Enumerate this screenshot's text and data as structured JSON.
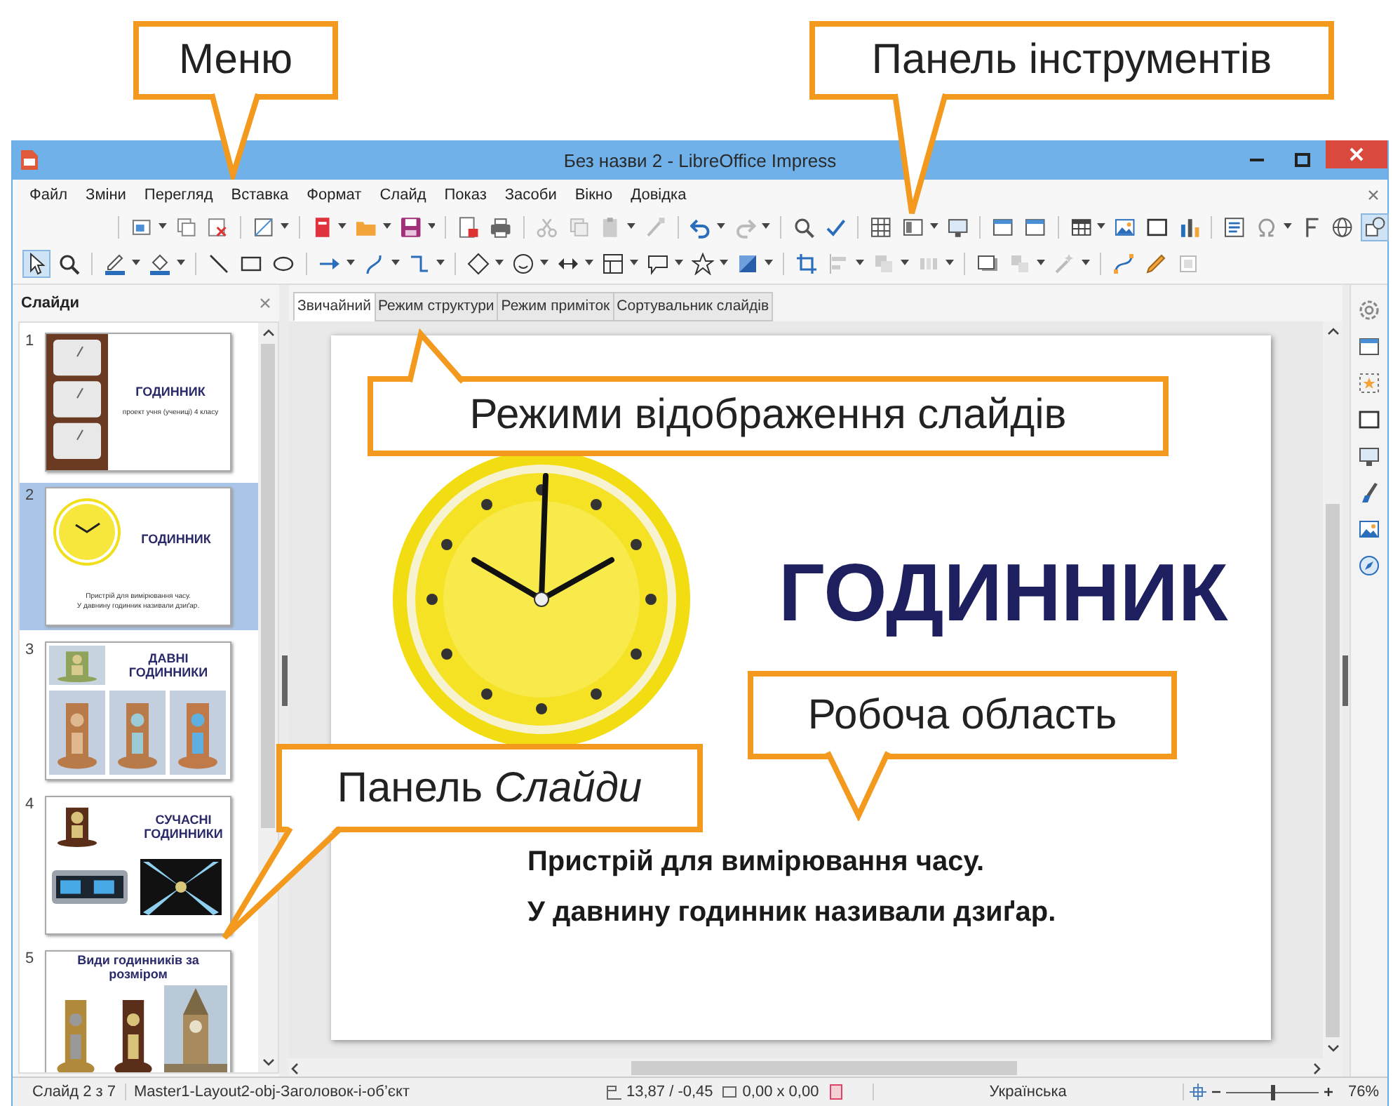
{
  "callouts": [
    {
      "text": "Меню"
    },
    {
      "text": "Панель інструментів"
    },
    {
      "text": "Режими відображення слайдів"
    },
    {
      "text": "Робоча область"
    },
    {
      "text": "Панель *Слайди*"
    }
  ],
  "window": {
    "title": "Без назви 2 - LibreOffice Impress"
  },
  "menu": [
    "Файл",
    "Зміни",
    "Перегляд",
    "Вставка",
    "Формат",
    "Слайд",
    "Показ",
    "Засоби",
    "Вікно",
    "Довідка"
  ],
  "tabs": [
    {
      "label": "Звичайний",
      "selected": true
    },
    {
      "label": "Режим структури",
      "selected": false
    },
    {
      "label": "Режим приміток",
      "selected": false
    },
    {
      "label": "Сортувальник слайдів",
      "selected": false
    }
  ],
  "slides_panel": {
    "title": "Слайди",
    "slides": [
      {
        "number": "1",
        "selected": false,
        "kind": "cover",
        "title": "ГОДИННИК",
        "lines": [
          "проект учня (учениці) 4 класу"
        ]
      },
      {
        "number": "2",
        "selected": true,
        "kind": "clock",
        "title": "ГОДИННИК",
        "lines": [
          "Пристрій для вимірювання часу.",
          "У давнину годинник називали дзиґар."
        ]
      },
      {
        "number": "3",
        "selected": false,
        "kind": "gallery",
        "title": "ДАВНІ ГОДИННИКИ"
      },
      {
        "number": "4",
        "selected": false,
        "kind": "mixed",
        "title": "СУЧАСНІ ГОДИННИКИ"
      },
      {
        "number": "5",
        "selected": false,
        "kind": "sizes",
        "title": "Види годинників за розміром"
      }
    ]
  },
  "slide": {
    "title": "ГОДИННИК",
    "lines": [
      "Пристрій для вимірювання часу.",
      "У давнину годинник називали дзиґар."
    ]
  },
  "status_bar": {
    "slide": "Слайд 2 з 7",
    "layout": "Master1-Layout2-obj-Заголовок-і-об’єкт",
    "position": "13,87 / -0,45",
    "size": "0,00 x 0,00",
    "language": "Українська",
    "zoom": {
      "level": 0.5
    },
    "zoom_percent": "76%"
  }
}
